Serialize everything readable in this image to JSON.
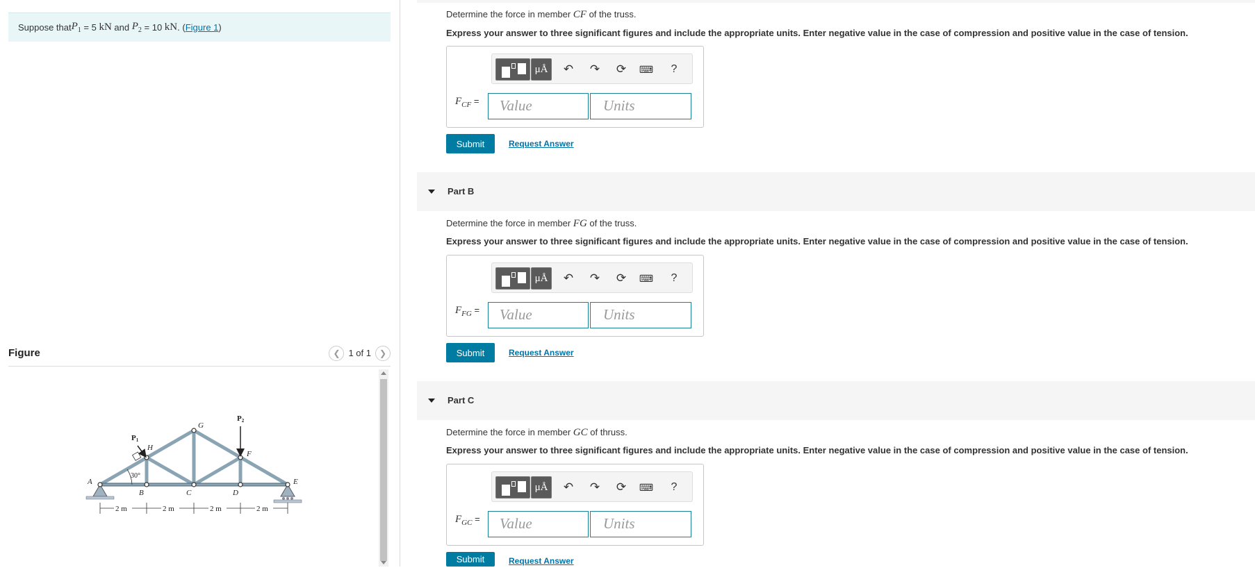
{
  "problem": {
    "prefix": "Suppose that ",
    "p1_sym": "P",
    "p1_sub": "1",
    "p1_eq": " = 5 ",
    "p1_unit": "kN",
    "and": " and ",
    "p2_sym": "P",
    "p2_sub": "2",
    "p2_eq": " = 10 ",
    "p2_unit": "kN",
    "dot": ". (",
    "link": "Figure 1",
    "close": ")"
  },
  "figure": {
    "title": "Figure",
    "pager": "1 of 1",
    "prev_icon": "chevron-left-icon",
    "next_icon": "chevron-right-icon",
    "labels": {
      "A": "A",
      "B": "B",
      "C": "C",
      "D": "D",
      "E": "E",
      "F": "F",
      "G": "G",
      "H": "H",
      "P1": "P",
      "P1sub": "1",
      "P2": "P",
      "P2sub": "2",
      "angle": "30°",
      "d1": "2 m",
      "d2": "2 m",
      "d3": "2 m",
      "d4": "2 m"
    }
  },
  "toolbar": {
    "mu_label": "μÅ",
    "undo_icon": "undo-icon",
    "redo_icon": "redo-icon",
    "reset_icon": "reset-icon",
    "keyboard_icon": "keyboard-icon",
    "help_label": "?"
  },
  "parts": [
    {
      "header": "",
      "q_prefix": "Determine the force in member ",
      "q_member": "CF",
      "q_suffix": " of the truss.",
      "instructions": "Express your answer to three significant figures and include the appropriate units. Enter negative value in the case of compression and positive value in the case of tension.",
      "label_sym": "F",
      "label_sub": "CF",
      "label_eq": " =",
      "value_placeholder": "Value",
      "units_placeholder": "Units",
      "submit": "Submit",
      "request": "Request Answer"
    },
    {
      "header": "Part B",
      "q_prefix": "Determine the force in member ",
      "q_member": "FG",
      "q_suffix": " of the truss.",
      "instructions": "Express your answer to three significant figures and include the appropriate units. Enter negative value in the case of compression and positive value in the case of tension.",
      "label_sym": "F",
      "label_sub": "FG",
      "label_eq": " =",
      "value_placeholder": "Value",
      "units_placeholder": "Units",
      "submit": "Submit",
      "request": "Request Answer"
    },
    {
      "header": "Part C",
      "q_prefix": "Determine the force in member ",
      "q_member": "GC",
      "q_suffix": " of thruss.",
      "instructions": "Express your answer to three significant figures and include the appropriate units. Enter negative value in the case of compression and positive value in the case of tension.",
      "label_sym": "F",
      "label_sub": "GC",
      "label_eq": " =",
      "value_placeholder": "Value",
      "units_placeholder": "Units",
      "submit": "Submit",
      "request": "Request Answer"
    }
  ]
}
